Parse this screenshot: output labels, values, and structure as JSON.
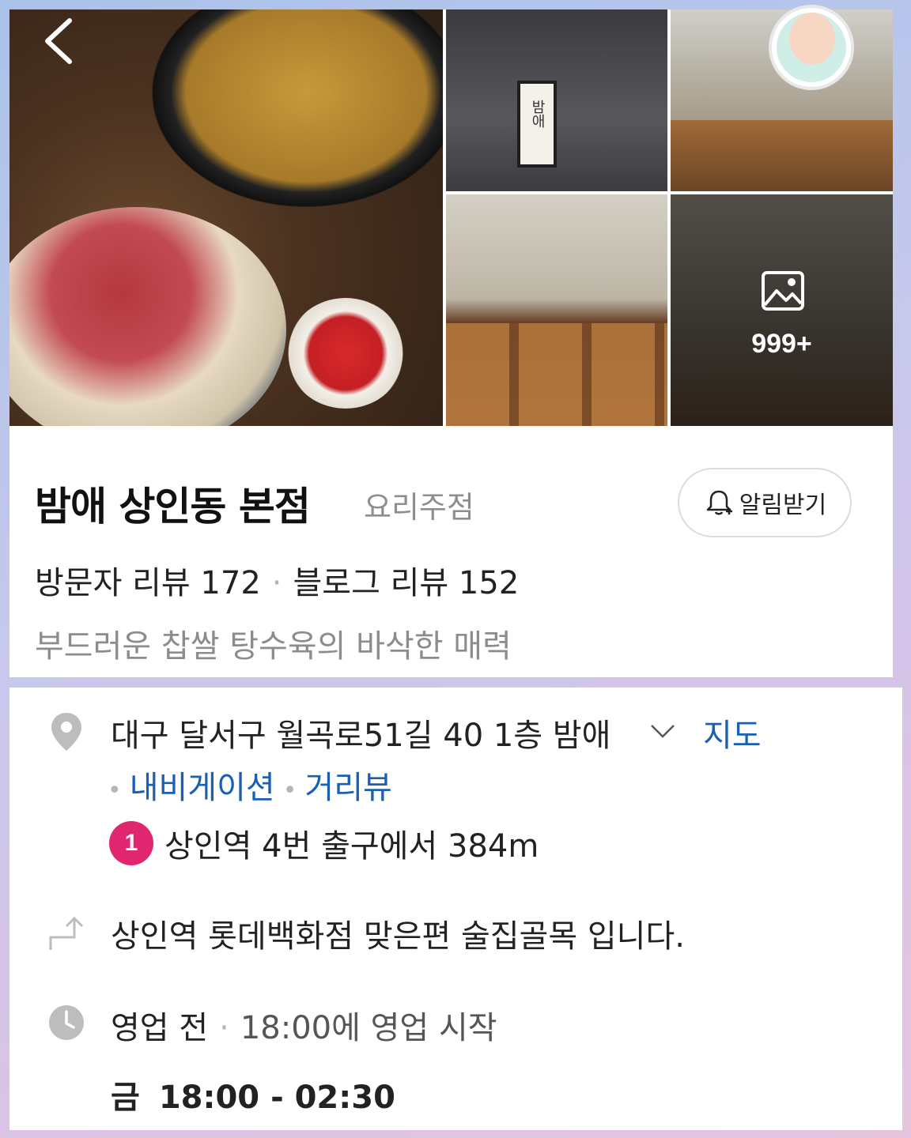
{
  "gallery": {
    "back_icon": "chevron-left-icon",
    "sign_text": "밤애",
    "more_icon": "image-icon",
    "photo_count": "999+"
  },
  "place": {
    "name": "밤애 상인동 본점",
    "category": "요리주점",
    "alarm_button": "알림받기",
    "visitor_review": "방문자 리뷰 172",
    "blog_review": "블로그 리뷰 152",
    "description": "부드러운 찹쌀 탕수육의 바삭한 매력"
  },
  "details": {
    "address": "대구 달서구 월곡로51길 40 1층 밤애",
    "map_link": "지도",
    "navigation_link": "내비게이션",
    "street_view_link": "거리뷰",
    "subway_line": "1",
    "subway_line_color": "#e0266f",
    "subway_text": "상인역 4번 출구에서 384m",
    "directions": "상인역 롯데백화점 맞은편 술집골목 입니다.",
    "status": "영업 전",
    "status_detail": "18:00에 영업 시작",
    "day": "금",
    "hours": "18:00 - 02:30"
  },
  "colors": {
    "link": "#1a5fb4",
    "subway_badge": "#e0266f"
  }
}
